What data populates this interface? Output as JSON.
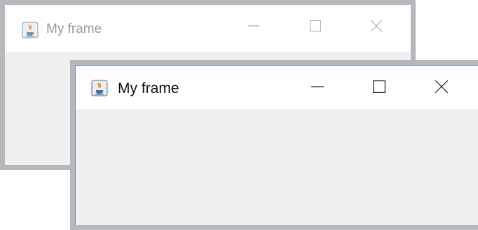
{
  "windows": {
    "back": {
      "title": "My frame",
      "icon": "java-coffee-icon",
      "active": false
    },
    "front": {
      "title": "My frame",
      "icon": "java-coffee-icon",
      "active": true
    }
  },
  "controls": [
    "minimize-icon",
    "maximize-icon",
    "close-icon"
  ],
  "colors": {
    "frame_border": "#b5b8bc",
    "titlebar_bg": "#ffffff",
    "client_bg": "#eeefef",
    "active_title_text": "#111111",
    "inactive_title_text": "#9a9a9a"
  }
}
